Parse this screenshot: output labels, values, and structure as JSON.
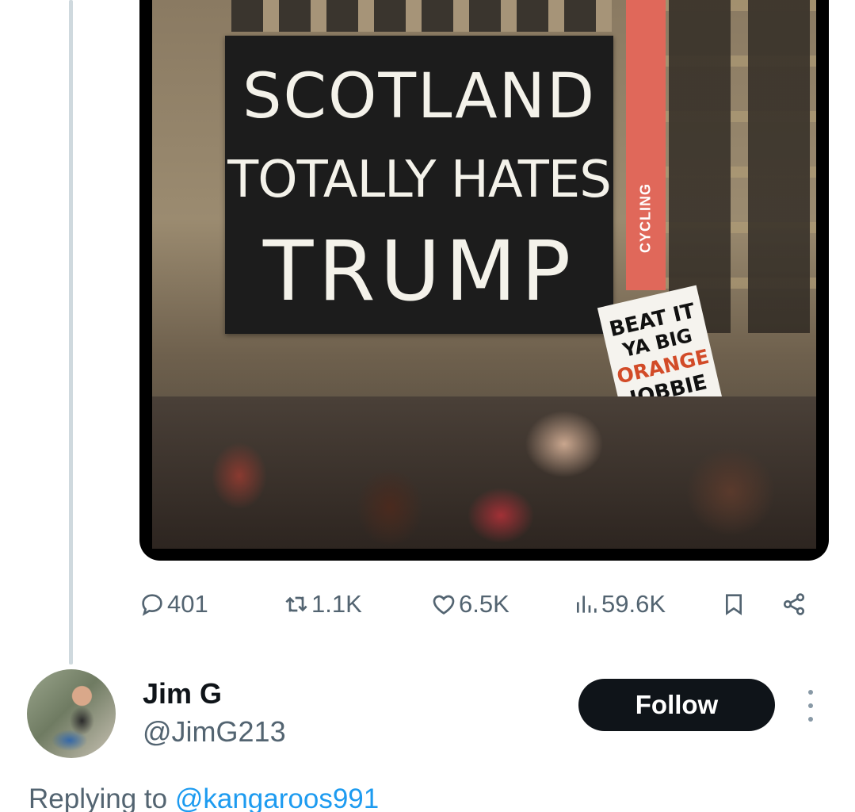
{
  "tweet": {
    "image": {
      "sign_lines": [
        "SCOTLAND",
        "TOTALLY HATES",
        "TRUMP"
      ],
      "small_sign_lines": [
        "BEAT IT",
        "YA BIG",
        "ORANGE",
        "JOBBIE"
      ],
      "banner_text": "CYCLING",
      "small_sign_accent": "#d24b28"
    },
    "stats": {
      "replies": "401",
      "retweets": "1.1K",
      "likes": "6.5K",
      "views": "59.6K"
    }
  },
  "reply_tweet": {
    "author_name": "Jim G",
    "author_handle": "@JimG213",
    "follow_label": "Follow",
    "replying_prefix": "Replying to",
    "replying_to": "@kangaroos991"
  },
  "colors": {
    "text_primary": "#0f1419",
    "text_secondary": "#536471",
    "link": "#1d9bf0",
    "follow_bg": "#0f1419",
    "thread_line": "#cfd9de"
  },
  "icons": [
    "reply-icon",
    "retweet-icon",
    "like-icon",
    "views-icon",
    "bookmark-icon",
    "share-icon",
    "more-icon"
  ]
}
